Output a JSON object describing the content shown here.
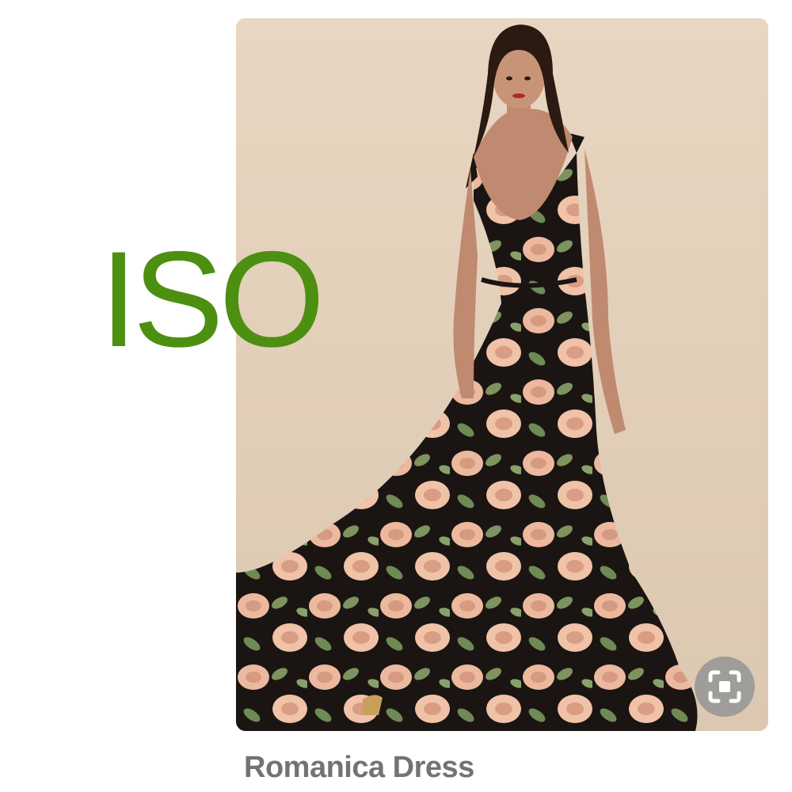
{
  "overlay": {
    "text": "ISO",
    "color": "#4d8f10"
  },
  "product": {
    "title": "Romanica Dress"
  },
  "lens_button": {
    "icon": "visual-search-icon"
  }
}
